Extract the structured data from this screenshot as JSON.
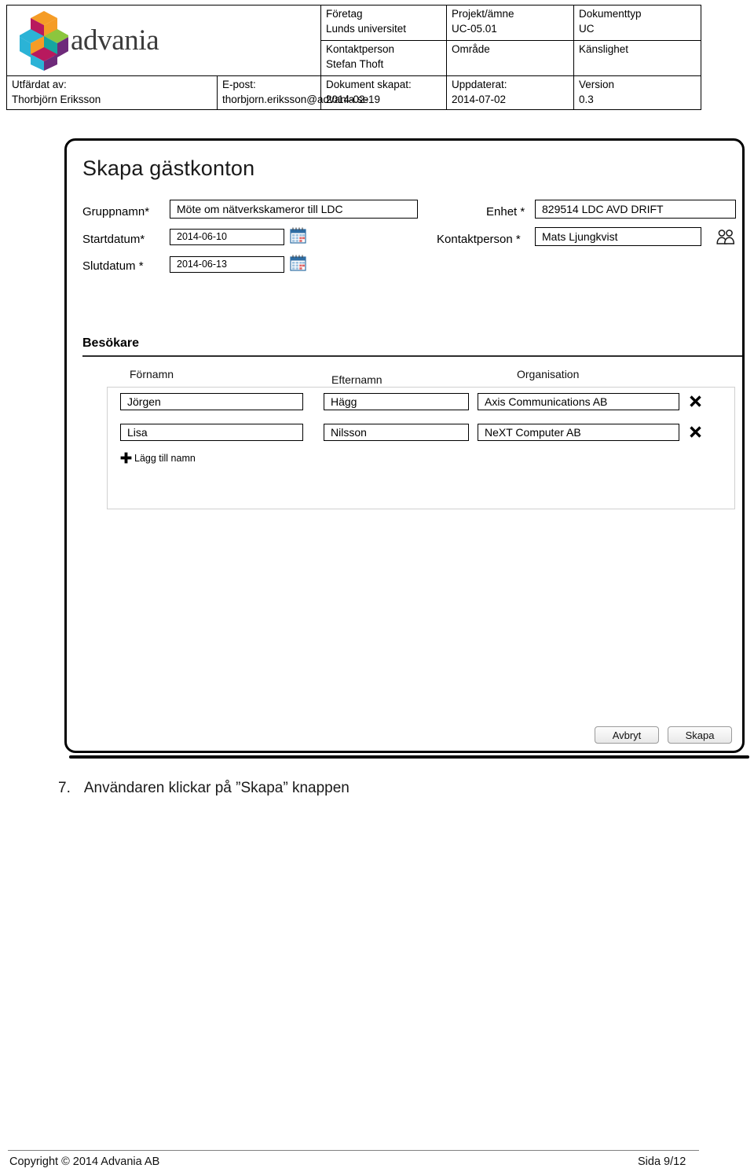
{
  "doc_header": {
    "logo_word": "advania",
    "cells": {
      "foretag_label": "Företag",
      "foretag_value": "Lunds universitet",
      "projekt_label": "Projekt/ämne",
      "projekt_value": "UC-05.01",
      "dokumenttyp_label": "Dokumenttyp",
      "dokumenttyp_value": "UC",
      "kontaktperson_label": "Kontaktperson",
      "kontaktperson_value": "Stefan Thoft",
      "omrade_label": "Område",
      "omrade_value": "",
      "kanslighet_label": "Känslighet",
      "kanslighet_value": "",
      "utfardat_label": "Utfärdat av:",
      "utfardat_value": "Thorbjörn Eriksson",
      "epost_label": "E-post:",
      "epost_value": "thorbjorn.eriksson@advania.se",
      "skapat_label": "Dokument skapat:",
      "skapat_value": "2014-02-19",
      "uppdaterat_label": "Uppdaterat:",
      "uppdaterat_value": "2014-07-02",
      "version_label": "Version",
      "version_value": "0.3"
    }
  },
  "screen": {
    "title": "Skapa gästkonton",
    "fields": {
      "gruppnamn_label": "Gruppnamn*",
      "gruppnamn_value": "Möte om nätverkskameror till LDC",
      "startdatum_label": "Startdatum*",
      "startdatum_value": "2014-06-10",
      "slutdatum_label": "Slutdatum *",
      "slutdatum_value": "2014-06-13",
      "enhet_label": "Enhet *",
      "enhet_value": "829514 LDC AVD DRIFT",
      "kontaktperson_label": "Kontaktperson *",
      "kontaktperson_value": "Mats Ljungkvist"
    },
    "icons": {
      "start_calendar": "calendar-icon",
      "end_calendar": "calendar-icon",
      "contact_picker": "people-picker-icon"
    },
    "visitors": {
      "heading": "Besökare",
      "columns": [
        "Förnamn",
        "Efternamn",
        "Organisation"
      ],
      "rows": [
        {
          "first_name": "Jörgen",
          "last_name": "Hägg",
          "organisation": "Axis Communications AB",
          "remove_icon": "remove-x-icon"
        },
        {
          "first_name": "Lisa",
          "last_name": "Nilsson",
          "organisation": "NeXT Computer AB",
          "remove_icon": "remove-x-icon"
        }
      ],
      "add_label": "Lägg till namn",
      "add_icon": "plus-icon"
    },
    "buttons": {
      "cancel": "Avbryt",
      "create": "Skapa"
    }
  },
  "caption": {
    "number": "7.",
    "text": "Användaren klickar på ”Skapa” knappen"
  },
  "footer": {
    "copyright": "Copyright © 2014 Advania AB",
    "page": "Sida 9/12"
  },
  "colors": {
    "logo_orange": "#F59C26",
    "logo_magenta": "#B8195E",
    "logo_purple": "#6E2A7A",
    "logo_cyan": "#2BB3D6",
    "logo_green": "#8CC63E",
    "logo_teal": "#16A5A0",
    "wordmark": "#3B3B3B",
    "calendar_blue": "#2E6DA4",
    "rule_gray": "#808080"
  }
}
